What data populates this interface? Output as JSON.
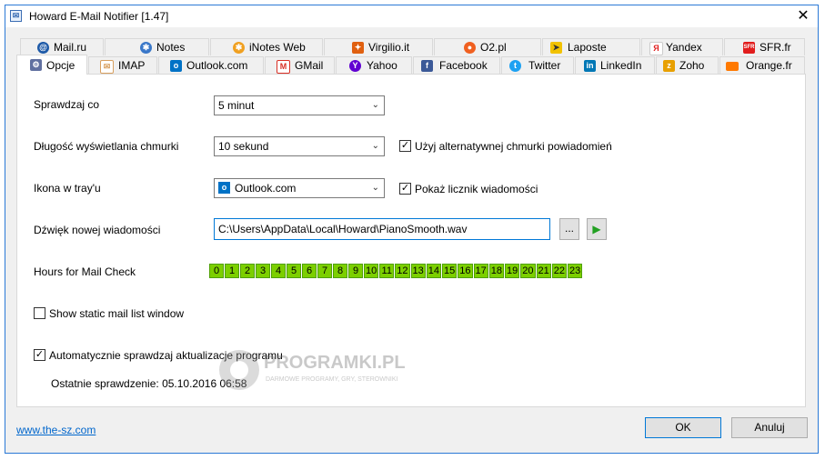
{
  "window": {
    "title": "Howard E-Mail Notifier [1.47]"
  },
  "tabs_top": [
    {
      "label": "Mail.ru",
      "icon": "mailru-icon",
      "color": "#1e5aa8"
    },
    {
      "label": "Notes",
      "icon": "notes-icon",
      "color": "#3a78c9"
    },
    {
      "label": "iNotes Web",
      "icon": "inotes-icon",
      "color": "#f0a020"
    },
    {
      "label": "Virgilio.it",
      "icon": "virgilio-icon",
      "color": "#e06010"
    },
    {
      "label": "O2.pl",
      "icon": "o2-icon",
      "color": "#f06020"
    },
    {
      "label": "Laposte",
      "icon": "laposte-icon",
      "color": "#f2c200"
    },
    {
      "label": "Yandex",
      "icon": "yandex-icon",
      "color": "#e02020"
    },
    {
      "label": "SFR.fr",
      "icon": "sfr-icon",
      "color": "#e11d1d"
    }
  ],
  "tabs_bottom": [
    {
      "label": "Opcje",
      "icon": "options-icon",
      "color": "#6070a0"
    },
    {
      "label": "IMAP",
      "icon": "envelope-icon",
      "color": "#d8a060"
    },
    {
      "label": "Outlook.com",
      "icon": "outlook-icon",
      "color": "#0072c6"
    },
    {
      "label": "GMail",
      "icon": "gmail-icon",
      "color": "#d93025"
    },
    {
      "label": "Yahoo",
      "icon": "yahoo-icon",
      "color": "#6001d2"
    },
    {
      "label": "Facebook",
      "icon": "facebook-icon",
      "color": "#3b5998"
    },
    {
      "label": "Twitter",
      "icon": "twitter-icon",
      "color": "#1da1f2"
    },
    {
      "label": "LinkedIn",
      "icon": "linkedin-icon",
      "color": "#0077b5"
    },
    {
      "label": "Zoho",
      "icon": "zoho-icon",
      "color": "#e8a000"
    },
    {
      "label": "Orange.fr",
      "icon": "orange-icon",
      "color": "#ff7900"
    }
  ],
  "options": {
    "check_interval_label": "Sprawdzaj co",
    "check_interval_value": "5 minut",
    "popup_duration_label": "Długość wyświetlania chmurki",
    "popup_duration_value": "10 sekund",
    "alt_popup_label": "Użyj alternatywnej chmurki powiadomień",
    "tray_icon_label": "Ikona w tray'u",
    "tray_icon_value": "Outlook.com",
    "show_counter_label": "Pokaż licznik wiadomości",
    "sound_label": "Dźwięk nowej wiadomości",
    "sound_value": "C:\\Users\\AppData\\Local\\Howard\\PianoSmooth.wav",
    "browse_label": "...",
    "hours_label": "Hours for Mail Check",
    "hours": [
      "0",
      "1",
      "2",
      "3",
      "4",
      "5",
      "6",
      "7",
      "8",
      "9",
      "10",
      "11",
      "12",
      "13",
      "14",
      "15",
      "16",
      "17",
      "18",
      "19",
      "20",
      "21",
      "22",
      "23"
    ],
    "static_list_label": "Show static mail list window",
    "auto_update_label": "Automatycznie sprawdzaj aktualizacje programu",
    "last_check_label": "Ostatnie sprawdzenie: 05.10.2016 06:58"
  },
  "watermark": {
    "text": "PROGRAMKI.PL",
    "subtext": "DARMOWE PROGRAMY, GRY, STEROWNIKI"
  },
  "footer": {
    "link": "www.the-sz.com",
    "ok": "OK",
    "cancel": "Anuluj"
  }
}
